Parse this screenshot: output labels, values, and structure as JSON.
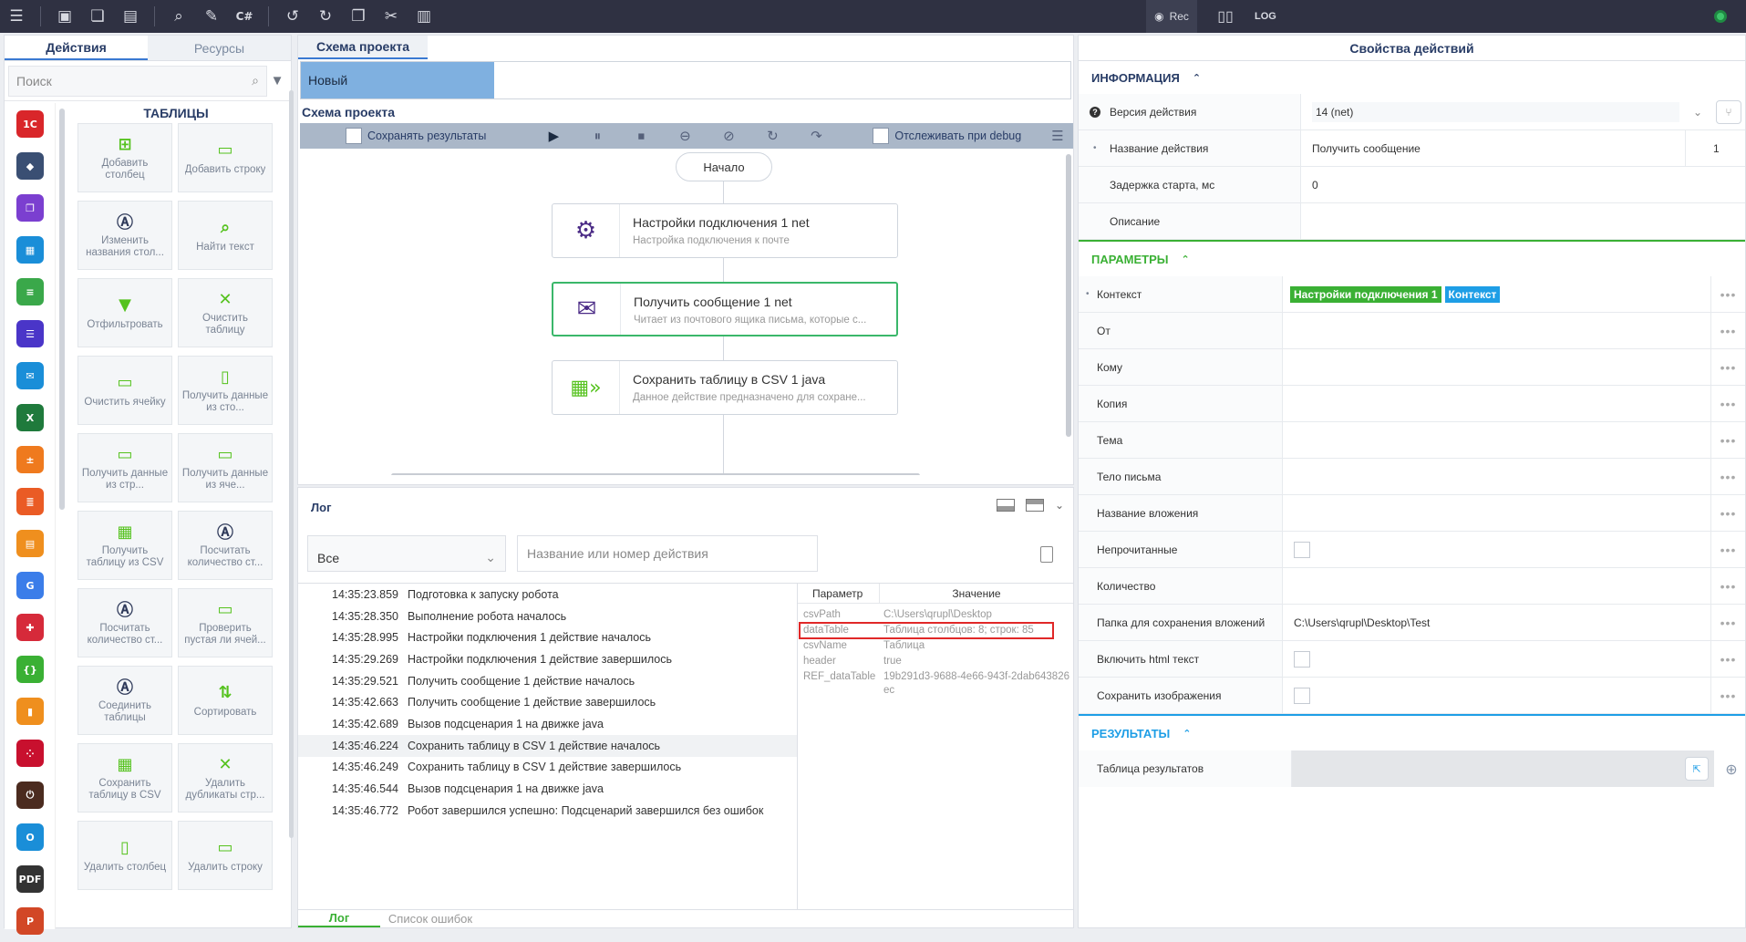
{
  "toolbar": {
    "rec_label": "Rec",
    "log_label": "LOG",
    "csharp_label": "C#"
  },
  "left_panel": {
    "tabs": [
      {
        "label": "Действия",
        "active": true
      },
      {
        "label": "Ресурсы",
        "active": false
      }
    ],
    "search_placeholder": "Поиск",
    "section_title": "ТАБЛИЦЫ",
    "actions": [
      {
        "label": "Добавить столбец",
        "icon": "add-column-icon"
      },
      {
        "label": "Добавить строку",
        "icon": "add-row-icon"
      },
      {
        "label": "Изменить названия стол...",
        "icon": "rename-columns-icon"
      },
      {
        "label": "Найти текст",
        "icon": "search-icon"
      },
      {
        "label": "Отфильтровать",
        "icon": "filter-icon"
      },
      {
        "label": "Очистить таблицу",
        "icon": "clear-table-icon"
      },
      {
        "label": "Очистить ячейку",
        "icon": "clear-cell-icon"
      },
      {
        "label": "Получить данные из сто...",
        "icon": "get-column-data-icon"
      },
      {
        "label": "Получить данные из стр...",
        "icon": "get-row-data-icon"
      },
      {
        "label": "Получить данные из яче...",
        "icon": "get-cell-data-icon"
      },
      {
        "label": "Получить таблицу из CSV",
        "icon": "csv-import-icon"
      },
      {
        "label": "Посчитать количество ст...",
        "icon": "count-columns-icon"
      },
      {
        "label": "Посчитать количество ст...",
        "icon": "count-rows-icon"
      },
      {
        "label": "Проверить пустая ли ячей...",
        "icon": "check-empty-icon"
      },
      {
        "label": "Соединить таблицы",
        "icon": "join-tables-icon"
      },
      {
        "label": "Сортировать",
        "icon": "sort-icon"
      },
      {
        "label": "Сохранить таблицу в CSV",
        "icon": "csv-export-icon"
      },
      {
        "label": "Удалить дубликаты стр...",
        "icon": "remove-duplicates-icon"
      },
      {
        "label": "Удалить столбец",
        "icon": "delete-column-icon"
      },
      {
        "label": "Удалить строку",
        "icon": "delete-row-icon"
      }
    ],
    "categories": [
      {
        "name": "1c-icon",
        "color": "#d9262a",
        "glyph": "1С"
      },
      {
        "name": "tag-icon",
        "color": "#3a4f73",
        "glyph": "◆"
      },
      {
        "name": "copy-icon",
        "color": "#7b3fd0",
        "glyph": "❐"
      },
      {
        "name": "calendar-icon",
        "color": "#1a8ed8",
        "glyph": "▦"
      },
      {
        "name": "database-icon",
        "color": "#3aa84a",
        "glyph": "≡"
      },
      {
        "name": "chat-icon",
        "color": "#4a35c8",
        "glyph": "☰"
      },
      {
        "name": "mail-icon",
        "color": "#1a8ed8",
        "glyph": "✉"
      },
      {
        "name": "excel-icon",
        "color": "#1f7a3c",
        "glyph": "X"
      },
      {
        "name": "calculator-icon",
        "color": "#ef7a1e",
        "glyph": "±"
      },
      {
        "name": "document-icon",
        "color": "#ea5b25",
        "glyph": "≣"
      },
      {
        "name": "clipboard-icon",
        "color": "#ef8f1e",
        "glyph": "▤"
      },
      {
        "name": "google-icon",
        "color": "#3b7de9",
        "glyph": "G"
      },
      {
        "name": "puzzle-icon",
        "color": "#d62a3a",
        "glyph": "✚"
      },
      {
        "name": "json-icon",
        "color": "#3ab034",
        "glyph": "{}"
      },
      {
        "name": "office-icon",
        "color": "#ef8f1e",
        "glyph": "▮"
      },
      {
        "name": "dots-icon",
        "color": "#c8102e",
        "glyph": "⁘"
      },
      {
        "name": "power-icon",
        "color": "#4b2b1f",
        "glyph": "⏻"
      },
      {
        "name": "outlook-icon",
        "color": "#1a8ed8",
        "glyph": "O"
      },
      {
        "name": "pdf-icon",
        "color": "#333333",
        "glyph": "PDF"
      },
      {
        "name": "powerpoint-icon",
        "color": "#d24726",
        "glyph": "P"
      }
    ]
  },
  "center": {
    "tab_label": "Схема проекта",
    "new_label": "Новый",
    "schema_title": "Схема проекта",
    "save_results_label": "Сохранять результаты",
    "track_debug_label": "Отслеживать при debug",
    "start_label": "Начало",
    "nodes": [
      {
        "title": "Настройки подключения  1  net",
        "desc": "Настройка подключения к почте",
        "icon": "gear-icon",
        "selected": false
      },
      {
        "title": "Получить сообщение  1  net",
        "desc": "Читает из почтового ящика письма, которые с...",
        "icon": "envelope-icon",
        "selected": true
      },
      {
        "title": "Сохранить таблицу в CSV  1  java",
        "desc": "Данное действие предназначено для сохране...",
        "icon": "csv-export-icon",
        "selected": false
      }
    ]
  },
  "log": {
    "title": "Лог",
    "filter_value": "Все",
    "search_placeholder": "Название или номер действия",
    "rows": [
      {
        "time": "14:35:23.859",
        "text": "Подготовка к запуску робота"
      },
      {
        "time": "14:35:28.350",
        "text": "Выполнение робота началось"
      },
      {
        "time": "14:35:28.995",
        "text": "Настройки подключения 1 действие началось"
      },
      {
        "time": "14:35:29.269",
        "text": "Настройки подключения 1 действие завершилось"
      },
      {
        "time": "14:35:29.521",
        "text": "Получить сообщение 1 действие началось"
      },
      {
        "time": "14:35:42.663",
        "text": "Получить сообщение 1 действие завершилось"
      },
      {
        "time": "14:35:42.689",
        "text": "Вызов подсценария 1 на движке java"
      },
      {
        "time": "14:35:46.224",
        "text": "Сохранить таблицу в CSV 1 действие началось"
      },
      {
        "time": "14:35:46.249",
        "text": "Сохранить таблицу в CSV 1 действие завершилось"
      },
      {
        "time": "14:35:46.544",
        "text": "Вызов подсценария 1 на движке java"
      },
      {
        "time": "14:35:46.772",
        "text": "Робот завершился успешно: Подсценарий завершился без ошибок"
      }
    ],
    "param_header": "Параметр",
    "value_header": "Значение",
    "params": [
      {
        "key": "csvPath",
        "value": "C:\\Users\\qrupl\\Desktop"
      },
      {
        "key": "dataTable",
        "value": "Таблица столбцов: 8; строк: 85"
      },
      {
        "key": "csvName",
        "value": "Таблица"
      },
      {
        "key": "header",
        "value": "true"
      },
      {
        "key": "REF_dataTable",
        "value": "19b291d3-9688-4e66-943f-2dab643826ec"
      }
    ],
    "bottom_tabs": [
      {
        "label": "Лог",
        "active": true
      },
      {
        "label": "Список ошибок",
        "active": false
      }
    ]
  },
  "right_panel": {
    "title": "Свойства действий",
    "info_section": "ИНФОРМАЦИЯ",
    "params_section": "ПАРАМЕТРЫ",
    "results_section": "РЕЗУЛЬТАТЫ",
    "info_rows": [
      {
        "label": "Версия действия",
        "value": "14 (net)"
      },
      {
        "label": "Название действия",
        "value": "Получить сообщение",
        "extra": "1"
      },
      {
        "label": "Задержка старта, мс",
        "value": "0"
      },
      {
        "label": "Описание",
        "value": ""
      }
    ],
    "context_label": "Контекст",
    "context_tag1": "Настройки подключения 1",
    "context_tag2": "Контекст",
    "param_rows": [
      {
        "label": "От",
        "value": ""
      },
      {
        "label": "Кому",
        "value": ""
      },
      {
        "label": "Копия",
        "value": ""
      },
      {
        "label": "Тема",
        "value": ""
      },
      {
        "label": "Тело письма",
        "value": ""
      },
      {
        "label": "Название вложения",
        "value": ""
      },
      {
        "label": "Непрочитанные",
        "value": ""
      },
      {
        "label": "Количество",
        "value": ""
      },
      {
        "label": "Папка для сохранения вложений",
        "value": "C:\\Users\\qrupl\\Desktop\\Test"
      },
      {
        "label": "Включить html текст",
        "value": ""
      },
      {
        "label": "Сохранить изображения",
        "value": ""
      }
    ],
    "results_row_label": "Таблица результатов",
    "colors": {
      "info": "#283c66",
      "params": "#3ab034",
      "results": "#1e9ee6"
    }
  }
}
